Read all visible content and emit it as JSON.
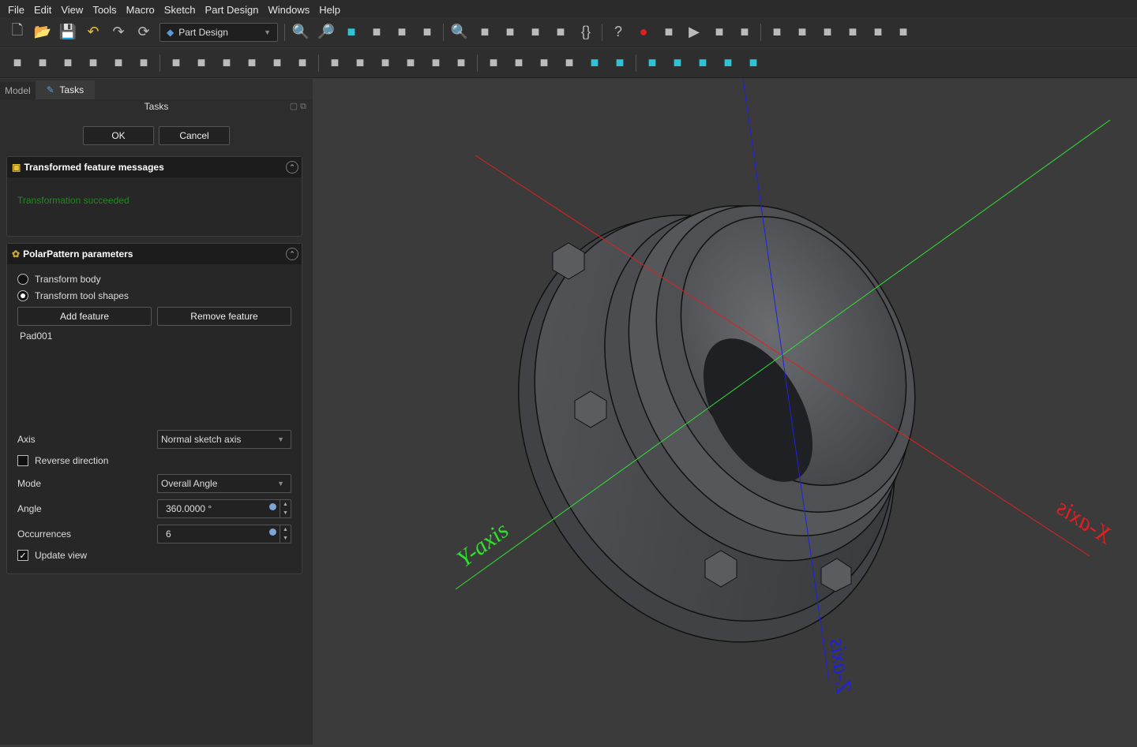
{
  "menu": [
    "File",
    "Edit",
    "View",
    "Tools",
    "Macro",
    "Sketch",
    "Part Design",
    "Windows",
    "Help"
  ],
  "toolbar1": {
    "workbench": "Part Design",
    "icons": [
      "new-file",
      "open-file",
      "save",
      "undo",
      "redo",
      "refresh",
      "fit-all",
      "fit-selection",
      "view-isometric",
      "std-view",
      "draw-style",
      "bounding-box",
      "zoom",
      "measure",
      "part",
      "group",
      "link",
      "braces",
      "whats-this",
      "record-macro",
      "macro-edit",
      "run-macro",
      "body",
      "sketch",
      "validate-sketch",
      "datum-point",
      "shape-binder",
      "clone",
      "sub-shape",
      "datum-plane"
    ]
  },
  "toolbar2": {
    "icons": [
      "pad",
      "revolution",
      "additive-loft",
      "additive-pipe",
      "additive-helix",
      "additive-primitive",
      "pocket",
      "hole",
      "groove",
      "subtractive-loft",
      "subtractive-pipe",
      "subtractive-helix",
      "subtractive-primitive",
      "boolean",
      "fillet",
      "chamfer",
      "draft",
      "thickness",
      "mirrored",
      "linear-pattern",
      "polar-pattern",
      "multi-transform",
      "view-front",
      "view-top",
      "view-right",
      "view-rear",
      "view-bottom",
      "view-left",
      "view-axonometric"
    ]
  },
  "panel": {
    "tabs": [
      "Model",
      "Tasks"
    ],
    "title": "Tasks",
    "ok": "OK",
    "cancel": "Cancel"
  },
  "messages": {
    "title": "Transformed feature messages",
    "text": "Transformation succeeded",
    "text_color": "#1f8a1f"
  },
  "params": {
    "title": "PolarPattern parameters",
    "radio_body": "Transform body",
    "radio_tool": "Transform tool shapes",
    "selected": "Transform tool shapes",
    "add": "Add feature",
    "remove": "Remove feature",
    "features": [
      "Pad001"
    ],
    "axis_label": "Axis",
    "axis_value": "Normal sketch axis",
    "reverse": "Reverse direction",
    "reverse_checked": false,
    "mode_label": "Mode",
    "mode_value": "Overall Angle",
    "angle_label": "Angle",
    "angle_value": "360.0000 °",
    "occ_label": "Occurrences",
    "occ_value": "6",
    "update": "Update view",
    "update_checked": true
  },
  "viewport": {
    "x_label": "X-axis",
    "y_label": "Y-axis",
    "z_label": "Z-axis",
    "x_color": "#e02020",
    "y_color": "#30e030",
    "z_color": "#2020e0"
  }
}
